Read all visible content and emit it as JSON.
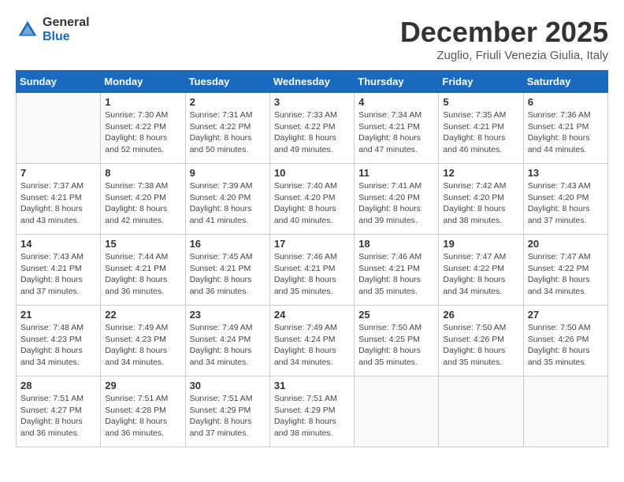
{
  "header": {
    "logo_general": "General",
    "logo_blue": "Blue",
    "month_title": "December 2025",
    "subtitle": "Zuglio, Friuli Venezia Giulia, Italy"
  },
  "days_of_week": [
    "Sunday",
    "Monday",
    "Tuesday",
    "Wednesday",
    "Thursday",
    "Friday",
    "Saturday"
  ],
  "weeks": [
    [
      {
        "day": "",
        "info": ""
      },
      {
        "day": "1",
        "info": "Sunrise: 7:30 AM\nSunset: 4:22 PM\nDaylight: 8 hours\nand 52 minutes."
      },
      {
        "day": "2",
        "info": "Sunrise: 7:31 AM\nSunset: 4:22 PM\nDaylight: 8 hours\nand 50 minutes."
      },
      {
        "day": "3",
        "info": "Sunrise: 7:33 AM\nSunset: 4:22 PM\nDaylight: 8 hours\nand 49 minutes."
      },
      {
        "day": "4",
        "info": "Sunrise: 7:34 AM\nSunset: 4:21 PM\nDaylight: 8 hours\nand 47 minutes."
      },
      {
        "day": "5",
        "info": "Sunrise: 7:35 AM\nSunset: 4:21 PM\nDaylight: 8 hours\nand 46 minutes."
      },
      {
        "day": "6",
        "info": "Sunrise: 7:36 AM\nSunset: 4:21 PM\nDaylight: 8 hours\nand 44 minutes."
      }
    ],
    [
      {
        "day": "7",
        "info": "Sunrise: 7:37 AM\nSunset: 4:21 PM\nDaylight: 8 hours\nand 43 minutes."
      },
      {
        "day": "8",
        "info": "Sunrise: 7:38 AM\nSunset: 4:20 PM\nDaylight: 8 hours\nand 42 minutes."
      },
      {
        "day": "9",
        "info": "Sunrise: 7:39 AM\nSunset: 4:20 PM\nDaylight: 8 hours\nand 41 minutes."
      },
      {
        "day": "10",
        "info": "Sunrise: 7:40 AM\nSunset: 4:20 PM\nDaylight: 8 hours\nand 40 minutes."
      },
      {
        "day": "11",
        "info": "Sunrise: 7:41 AM\nSunset: 4:20 PM\nDaylight: 8 hours\nand 39 minutes."
      },
      {
        "day": "12",
        "info": "Sunrise: 7:42 AM\nSunset: 4:20 PM\nDaylight: 8 hours\nand 38 minutes."
      },
      {
        "day": "13",
        "info": "Sunrise: 7:43 AM\nSunset: 4:20 PM\nDaylight: 8 hours\nand 37 minutes."
      }
    ],
    [
      {
        "day": "14",
        "info": "Sunrise: 7:43 AM\nSunset: 4:21 PM\nDaylight: 8 hours\nand 37 minutes."
      },
      {
        "day": "15",
        "info": "Sunrise: 7:44 AM\nSunset: 4:21 PM\nDaylight: 8 hours\nand 36 minutes."
      },
      {
        "day": "16",
        "info": "Sunrise: 7:45 AM\nSunset: 4:21 PM\nDaylight: 8 hours\nand 36 minutes."
      },
      {
        "day": "17",
        "info": "Sunrise: 7:46 AM\nSunset: 4:21 PM\nDaylight: 8 hours\nand 35 minutes."
      },
      {
        "day": "18",
        "info": "Sunrise: 7:46 AM\nSunset: 4:21 PM\nDaylight: 8 hours\nand 35 minutes."
      },
      {
        "day": "19",
        "info": "Sunrise: 7:47 AM\nSunset: 4:22 PM\nDaylight: 8 hours\nand 34 minutes."
      },
      {
        "day": "20",
        "info": "Sunrise: 7:47 AM\nSunset: 4:22 PM\nDaylight: 8 hours\nand 34 minutes."
      }
    ],
    [
      {
        "day": "21",
        "info": "Sunrise: 7:48 AM\nSunset: 4:23 PM\nDaylight: 8 hours\nand 34 minutes."
      },
      {
        "day": "22",
        "info": "Sunrise: 7:49 AM\nSunset: 4:23 PM\nDaylight: 8 hours\nand 34 minutes."
      },
      {
        "day": "23",
        "info": "Sunrise: 7:49 AM\nSunset: 4:24 PM\nDaylight: 8 hours\nand 34 minutes."
      },
      {
        "day": "24",
        "info": "Sunrise: 7:49 AM\nSunset: 4:24 PM\nDaylight: 8 hours\nand 34 minutes."
      },
      {
        "day": "25",
        "info": "Sunrise: 7:50 AM\nSunset: 4:25 PM\nDaylight: 8 hours\nand 35 minutes."
      },
      {
        "day": "26",
        "info": "Sunrise: 7:50 AM\nSunset: 4:26 PM\nDaylight: 8 hours\nand 35 minutes."
      },
      {
        "day": "27",
        "info": "Sunrise: 7:50 AM\nSunset: 4:26 PM\nDaylight: 8 hours\nand 35 minutes."
      }
    ],
    [
      {
        "day": "28",
        "info": "Sunrise: 7:51 AM\nSunset: 4:27 PM\nDaylight: 8 hours\nand 36 minutes."
      },
      {
        "day": "29",
        "info": "Sunrise: 7:51 AM\nSunset: 4:28 PM\nDaylight: 8 hours\nand 36 minutes."
      },
      {
        "day": "30",
        "info": "Sunrise: 7:51 AM\nSunset: 4:29 PM\nDaylight: 8 hours\nand 37 minutes."
      },
      {
        "day": "31",
        "info": "Sunrise: 7:51 AM\nSunset: 4:29 PM\nDaylight: 8 hours\nand 38 minutes."
      },
      {
        "day": "",
        "info": ""
      },
      {
        "day": "",
        "info": ""
      },
      {
        "day": "",
        "info": ""
      }
    ]
  ]
}
